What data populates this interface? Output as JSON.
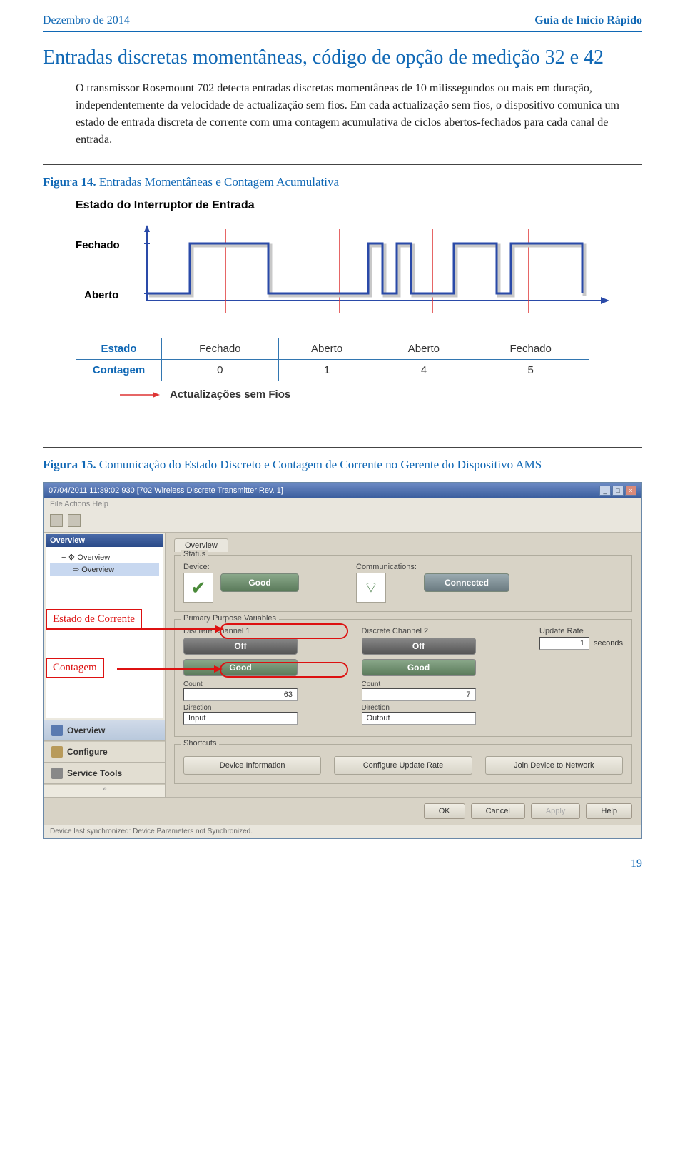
{
  "header": {
    "left": "Dezembro de 2014",
    "right": "Guia de Início Rápido"
  },
  "section": {
    "title": "Entradas discretas momentâneas, código de opção de medição 32 e 42",
    "body": "O transmissor Rosemount 702 detecta entradas discretas momentâneas de 10 milissegundos ou mais em duração, independentemente da velocidade de actualização sem fios. Em cada actualização sem fios, o dispositivo comunica um estado de entrada discreta de corrente com uma contagem acumulativa de ciclos abertos-fechados para cada canal de entrada."
  },
  "fig14": {
    "caption_bold": "Figura 14.",
    "caption_rest": " Entradas Momentâneas e Contagem Acumulativa",
    "subtitle": "Estado do Interruptor de Entrada",
    "y_closed": "Fechado",
    "y_open": "Aberto",
    "legend": "Actualizações sem Fios",
    "table": {
      "row1_hdr": "Estado",
      "row2_hdr": "Contagem",
      "cols": [
        {
          "state": "Fechado",
          "count": "0"
        },
        {
          "state": "Aberto",
          "count": "1"
        },
        {
          "state": "Aberto",
          "count": "4"
        },
        {
          "state": "Fechado",
          "count": "5"
        }
      ]
    }
  },
  "fig15": {
    "caption_bold": "Figura 15.",
    "caption_rest": " Comunicação do Estado Discreto e Contagem de Corrente no Gerente do Dispositivo AMS",
    "annot_current": "Estado de Corrente",
    "annot_count": "Contagem"
  },
  "ams": {
    "title": "07/04/2011 11:39:02 930 [702 Wireless Discrete Transmitter Rev. 1]",
    "menu": "File   Actions   Help",
    "sidebar": {
      "panel_title": "Overview",
      "tree1": "Overview",
      "tree2": "Overview",
      "btn_overview": "Overview",
      "btn_configure": "Configure",
      "btn_service": "Service Tools"
    },
    "tab": "Overview",
    "status": {
      "group": "Status",
      "device_lbl": "Device:",
      "device_btn": "Good",
      "comm_lbl": "Communications:",
      "comm_btn": "Connected"
    },
    "ppv": {
      "group": "Primary Purpose Variables",
      "ch1_lbl": "Discrete Channel 1",
      "ch1_state": "Off",
      "ch1_good": "Good",
      "ch1_count_lbl": "Count",
      "ch1_count": "63",
      "ch1_dir_lbl": "Direction",
      "ch1_dir": "Input",
      "ch2_lbl": "Discrete Channel 2",
      "ch2_state": "Off",
      "ch2_good": "Good",
      "ch2_count_lbl": "Count",
      "ch2_count": "7",
      "ch2_dir_lbl": "Direction",
      "ch2_dir": "Output",
      "ur_lbl": "Update Rate",
      "ur_val": "1",
      "ur_unit": "seconds"
    },
    "shortcuts": {
      "group": "Shortcuts",
      "btn1": "Device Information",
      "btn2": "Configure Update Rate",
      "btn3": "Join Device to Network"
    },
    "footer": {
      "ok": "OK",
      "cancel": "Cancel",
      "apply": "Apply",
      "help": "Help"
    },
    "statusbar": "Device last synchronized: Device Parameters not Synchronized."
  },
  "page_number": "19",
  "chart_data": {
    "type": "line",
    "title": "Estado do Interruptor de Entrada",
    "y_categories": [
      "Aberto",
      "Fechado"
    ],
    "series": [
      {
        "name": "Estado",
        "values": [
          "Aberto",
          "Fechado",
          "Aberto",
          "Fechado",
          "Aberto",
          "Fechado",
          "Aberto",
          "Fechado",
          "Aberto",
          "Fechado"
        ]
      }
    ],
    "sample_markers": [
      {
        "state": "Fechado",
        "count": 0
      },
      {
        "state": "Aberto",
        "count": 1
      },
      {
        "state": "Aberto",
        "count": 4
      },
      {
        "state": "Fechado",
        "count": 5
      }
    ],
    "legend": [
      "Actualizações sem Fios"
    ]
  }
}
